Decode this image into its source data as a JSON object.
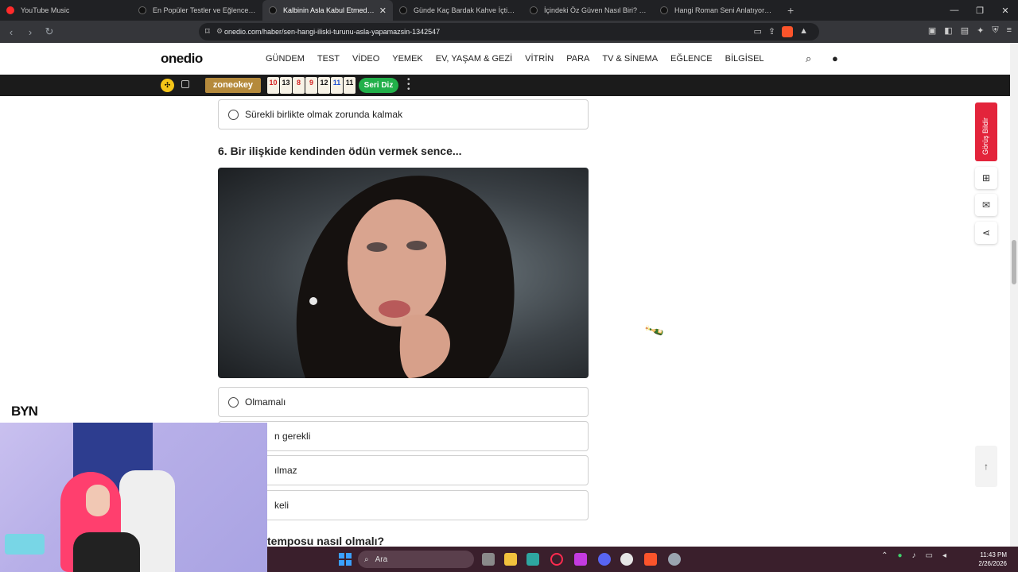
{
  "browser": {
    "tabs": [
      {
        "label": "YouTube Music",
        "active": false,
        "favicon": "youtube-music-icon"
      },
      {
        "label": "En Popüler Testler ve Eğlenceli Quizle",
        "active": false,
        "favicon": "onedio-icon"
      },
      {
        "label": "Kalbinin Asla Kabul Etmediği İlişk",
        "active": true,
        "favicon": "onedio-icon"
      },
      {
        "label": "Günde Kaç Bardak Kahve İçtiğini Tah",
        "active": false,
        "favicon": "onedio-icon"
      },
      {
        "label": "İçindeki Öz Güven Nasıl Biri? - Onedi",
        "active": false,
        "favicon": "onedio-icon"
      },
      {
        "label": "Hangi Roman Seni Anlatıyor? - Oned",
        "active": false,
        "favicon": "onedio-icon"
      }
    ],
    "url": "onedio.com/haber/sen-hangi-iliski-turunu-asla-yapamazsin-1342547",
    "brave_shield_count": "1"
  },
  "site": {
    "logo": "onedio",
    "nav": [
      "GÜNDEM",
      "TEST",
      "VİDEO",
      "YEMEK",
      "EV, YAŞAM & GEZİ",
      "VİTRİN",
      "PARA",
      "TV & SİNEMA",
      "EĞLENCE",
      "BİLGİSEL"
    ],
    "promo": {
      "brand": "zoneokey",
      "tiles": [
        {
          "value": "10",
          "color": "red"
        },
        {
          "value": "13",
          "color": "black"
        },
        {
          "value": "8",
          "color": "red"
        },
        {
          "value": "9",
          "color": "red"
        },
        {
          "value": "12",
          "color": "black"
        },
        {
          "value": "11",
          "color": "blue"
        },
        {
          "value": "11",
          "color": "black"
        }
      ],
      "button": "Seri Diz"
    }
  },
  "quiz": {
    "prev_option": "Sürekli birlikte olmak zorunda kalmak",
    "question": "6. Bir ilişkide kendinden ödün vermek sence...",
    "options": [
      "Olmamalı",
      "n gerekli",
      "ılmaz",
      "keli"
    ],
    "next_question": "temposu nasıl olmalı?"
  },
  "sidebar": {
    "feedback_label": "Görüş Bildir"
  },
  "overlay": {
    "stream_logo_text": "BYN"
  },
  "taskbar": {
    "search_placeholder": "Ara",
    "time": "11:43 PM",
    "date": "2/26/2026"
  },
  "colors": {
    "feedback_red": "#e3243b",
    "seri_diz_green": "#22b04a",
    "taskbar_bg": "#3a1f2c",
    "chrome_bg": "#202124"
  }
}
